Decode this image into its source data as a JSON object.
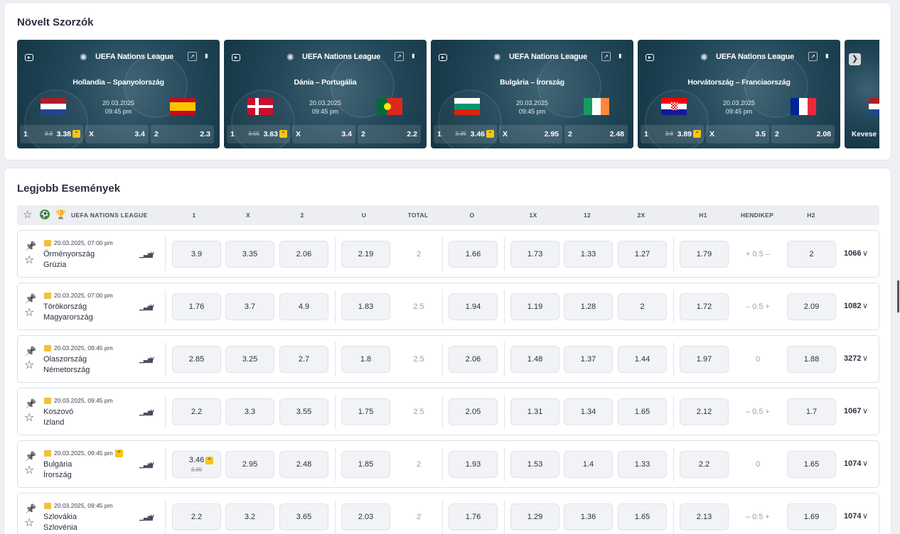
{
  "promo": {
    "title": "Növelt Szorzók",
    "cards": [
      {
        "league": "UEFA Nations League",
        "match": "Hollandia – Spanyolország",
        "date": "20.03.2025",
        "time": "09:45 pm",
        "o1_old": "3.3",
        "o1": "3.38",
        "ox": "3.4",
        "o2": "2.3",
        "flag_left": "nl",
        "flag_right": "es"
      },
      {
        "league": "UEFA Nations League",
        "match": "Dánia – Portugália",
        "date": "20.03.2025",
        "time": "09:45 pm",
        "o1_old": "3.55",
        "o1": "3.63",
        "ox": "3.4",
        "o2": "2.2",
        "flag_left": "dk",
        "flag_right": "pt"
      },
      {
        "league": "UEFA Nations League",
        "match": "Bulgária – Írország",
        "date": "20.03.2025",
        "time": "09:45 pm",
        "o1_old": "3.35",
        "o1": "3.46",
        "ox": "2.95",
        "o2": "2.48",
        "flag_left": "bg",
        "flag_right": "ie"
      },
      {
        "league": "UEFA Nations League",
        "match": "Horvátország – Franciaország",
        "date": "20.03.2025",
        "time": "09:45 pm",
        "o1_old": "3.8",
        "o1": "3.89",
        "ox": "3.5",
        "o2": "2.08",
        "flag_left": "hr",
        "flag_right": "fr"
      }
    ],
    "lab1": "1",
    "labx": "X",
    "lab2": "2",
    "partial_label": "Kevese"
  },
  "events": {
    "title": "Legjobb Események",
    "league": "UEFA NATIONS LEAGUE",
    "columns": [
      "1",
      "X",
      "2",
      "U",
      "TOTAL",
      "O",
      "1X",
      "12",
      "2X",
      "H1",
      "HENDIKEP",
      "H2"
    ],
    "rows": [
      {
        "datetime": "20.03.2025, 07:00 pm",
        "home": "Örményország",
        "away": "Grúzia",
        "boosted": false,
        "o1": "3.9",
        "ox": "3.35",
        "o2": "2.06",
        "u": "2.19",
        "total": "2",
        "o": "1.66",
        "d1x": "1.73",
        "d12": "1.33",
        "d2x": "1.27",
        "h1": "1.79",
        "handicap": "+ 0.5 –",
        "h2": "2",
        "count": "1066"
      },
      {
        "datetime": "20.03.2025, 07:00 pm",
        "home": "Törökország",
        "away": "Magyarország",
        "boosted": false,
        "o1": "1.76",
        "ox": "3.7",
        "o2": "4.9",
        "u": "1.83",
        "total": "2.5",
        "o": "1.94",
        "d1x": "1.19",
        "d12": "1.28",
        "d2x": "2",
        "h1": "1.72",
        "handicap": "– 0.5 +",
        "h2": "2.09",
        "count": "1082"
      },
      {
        "datetime": "20.03.2025, 09:45 pm",
        "home": "Olaszország",
        "away": "Németország",
        "boosted": false,
        "o1": "2.85",
        "ox": "3.25",
        "o2": "2.7",
        "u": "1.8",
        "total": "2.5",
        "o": "2.06",
        "d1x": "1.48",
        "d12": "1.37",
        "d2x": "1.44",
        "h1": "1.97",
        "handicap": "0",
        "h2": "1.88",
        "count": "3272"
      },
      {
        "datetime": "20.03.2025, 09:45 pm",
        "home": "Koszovó",
        "away": "Izland",
        "boosted": false,
        "o1": "2.2",
        "ox": "3.3",
        "o2": "3.55",
        "u": "1.75",
        "total": "2.5",
        "o": "2.05",
        "d1x": "1.31",
        "d12": "1.34",
        "d2x": "1.65",
        "h1": "2.12",
        "handicap": "– 0.5 +",
        "h2": "1.7",
        "count": "1067"
      },
      {
        "datetime": "20.03.2025, 09:45 pm",
        "home": "Bulgária",
        "away": "Írország",
        "boosted": true,
        "o1": "3.46",
        "o1_old": "3.35",
        "ox": "2.95",
        "o2": "2.48",
        "u": "1.85",
        "total": "2",
        "o": "1.93",
        "d1x": "1.53",
        "d12": "1.4",
        "d2x": "1.33",
        "h1": "2.2",
        "handicap": "0",
        "h2": "1.65",
        "count": "1074"
      },
      {
        "datetime": "20.03.2025, 09:45 pm",
        "home": "Szlovákia",
        "away": "Szlovénia",
        "boosted": false,
        "o1": "2.2",
        "ox": "3.2",
        "o2": "3.65",
        "u": "2.03",
        "total": "2",
        "o": "1.76",
        "d1x": "1.29",
        "d12": "1.36",
        "d2x": "1.65",
        "h1": "2.13",
        "handicap": "– 0.5 +",
        "h2": "1.69",
        "count": "1074"
      }
    ]
  },
  "icons": {
    "play": "play-icon",
    "chart": "line-chart-icon",
    "stats": "bar-chart-icon",
    "star": "star-icon",
    "pin": "pin-icon",
    "ball": "football-icon",
    "trophy": "trophy-icon",
    "boost": "boost-icon",
    "chevron": "chevron-down-icon",
    "next": "chevron-right-icon"
  },
  "colors": {
    "card_bg": "#24495a",
    "boost": "#f5c518",
    "odd_bg": "#f1f3f7"
  }
}
